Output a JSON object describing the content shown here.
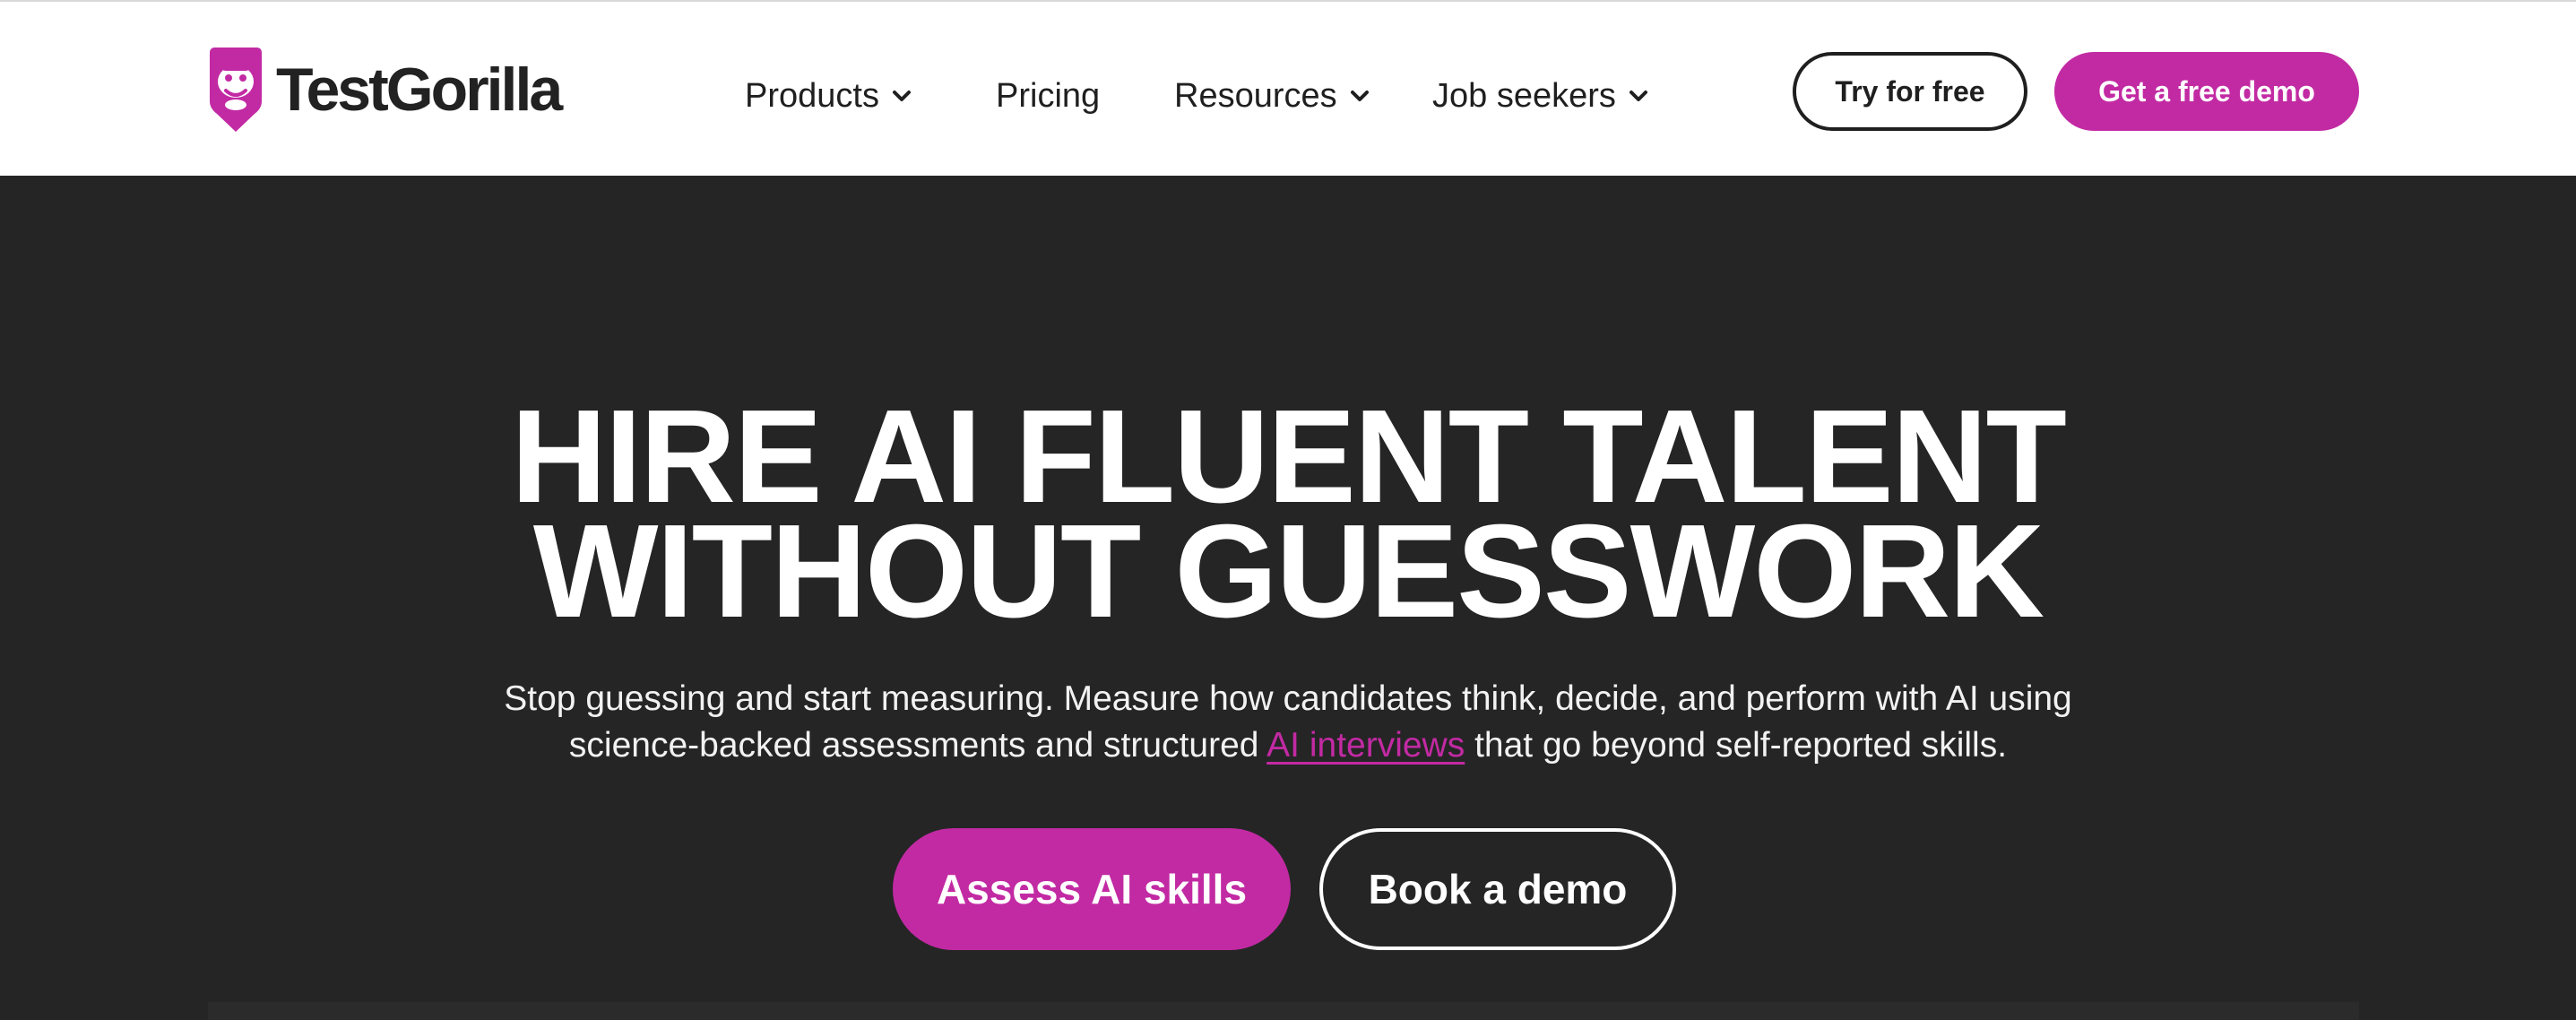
{
  "header": {
    "logo_text": "TestGorilla",
    "nav": {
      "products": "Products",
      "pricing": "Pricing",
      "resources": "Resources",
      "job_seekers": "Job seekers"
    },
    "try_free_label": "Try for free",
    "demo_label": "Get a free demo"
  },
  "hero": {
    "title_line1": "HIRE AI FLUENT TALENT",
    "title_line2": "WITHOUT GUESSWORK",
    "sub_line1": "Stop guessing and start measuring. Measure how candidates think, decide, and perform with AI using",
    "sub_line2_pre": "science-backed assessments and structured ",
    "sub_link": "AI interviews",
    "sub_line2_post": " that go beyond self-reported skills.",
    "cta_primary": "Assess AI skills",
    "cta_secondary": "Book a demo"
  },
  "colors": {
    "brand_magenta": "#c22aa3",
    "hero_bg": "#252525",
    "text_dark": "#1f1f1f"
  },
  "icons": {
    "logo": "gorilla-logo-icon",
    "dropdown": "chevron-down-icon"
  }
}
